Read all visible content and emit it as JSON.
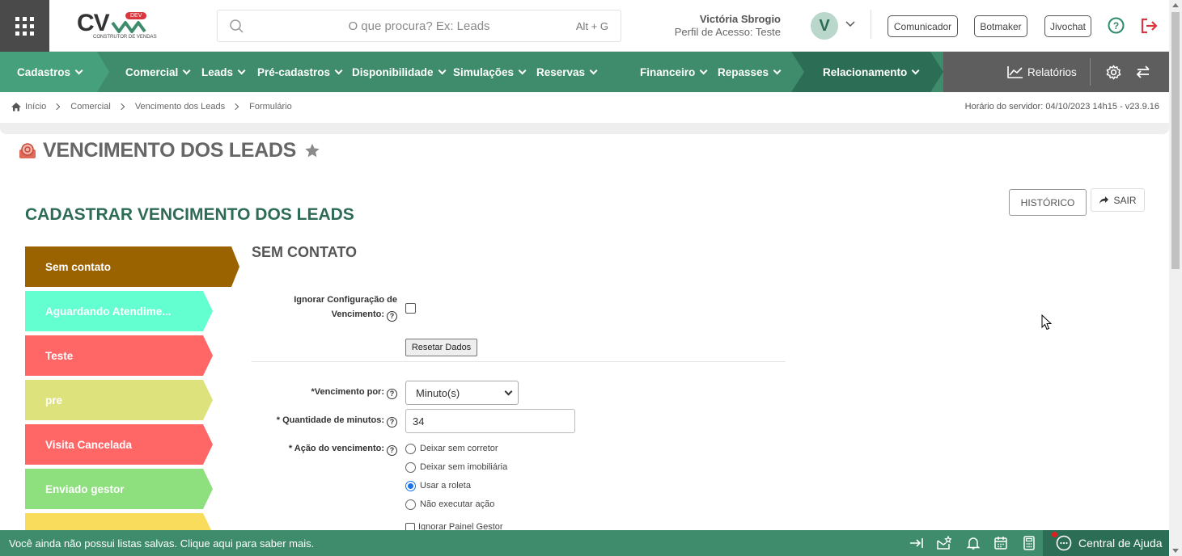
{
  "header": {
    "logo_text": "CV",
    "logo_badge": "DEV",
    "logo_subtitle": "CONSTRUTOR DE VENDAS",
    "search_placeholder": "O que procura? Ex: Leads",
    "search_shortcut": "Alt + G",
    "user_name": "Victória Sbrogio",
    "user_profile": "Perfil de Acesso: Teste",
    "avatar_initial": "V",
    "buttons": [
      "Comunicador",
      "Botmaker",
      "Jivochat"
    ]
  },
  "nav": {
    "items": [
      "Cadastros",
      "Comercial",
      "Leads",
      "Pré-cadastros",
      "Disponibilidade",
      "Simulações",
      "Reservas",
      "Financeiro",
      "Repasses",
      "Relacionamento"
    ],
    "reports": "Relatórios"
  },
  "breadcrumb": [
    "Início",
    "Comercial",
    "Vencimento dos Leads",
    "Formulário"
  ],
  "server_time": "Horário do servidor: 04/10/2023 14h15 - v23.9.16",
  "page_title": "VENCIMENTO DOS LEADS",
  "section_title": "CADASTRAR VENCIMENTO DOS LEADS",
  "actions": {
    "history": "HISTÓRICO",
    "exit": "SAIR"
  },
  "statuses": [
    {
      "label": "Sem contato",
      "color": "#9b6200"
    },
    {
      "label": "Aguardando Atendime...",
      "color": "#64ffd0"
    },
    {
      "label": "Teste",
      "color": "#ff6666"
    },
    {
      "label": "pre",
      "color": "#dde27c"
    },
    {
      "label": "Visita Cancelada",
      "color": "#ff6666"
    },
    {
      "label": "Enviado gestor",
      "color": "#8ee07e"
    },
    {
      "label": "",
      "color": "#f9dc5c"
    }
  ],
  "form": {
    "title": "SEM CONTATO",
    "ignore_label_line1": "Ignorar Configuração de",
    "ignore_label_line2": "Vencimento:",
    "reset_button": "Resetar Dados",
    "due_by_label": "*Vencimento por:",
    "due_by_value": "Minuto(s)",
    "minutes_label": "* Quantidade de minutos:",
    "minutes_value": "34",
    "action_label": "* Ação do vencimento:",
    "action_options": [
      "Deixar sem corretor",
      "Deixar sem imobiliária",
      "Usar a roleta",
      "Não executar ação"
    ],
    "action_selected": "Usar a roleta",
    "ignore_panel_label": "Ignorar Painel Gestor"
  },
  "footer": {
    "message": "Você ainda não possui listas salvas. Clique aqui para saber mais.",
    "help_center": "Central de Ajuda"
  },
  "colors": {
    "nav_green": "#3e8c6c",
    "dark_green": "#2c6e55",
    "title_green": "#2e6b55",
    "logout_red": "#d9363e"
  }
}
